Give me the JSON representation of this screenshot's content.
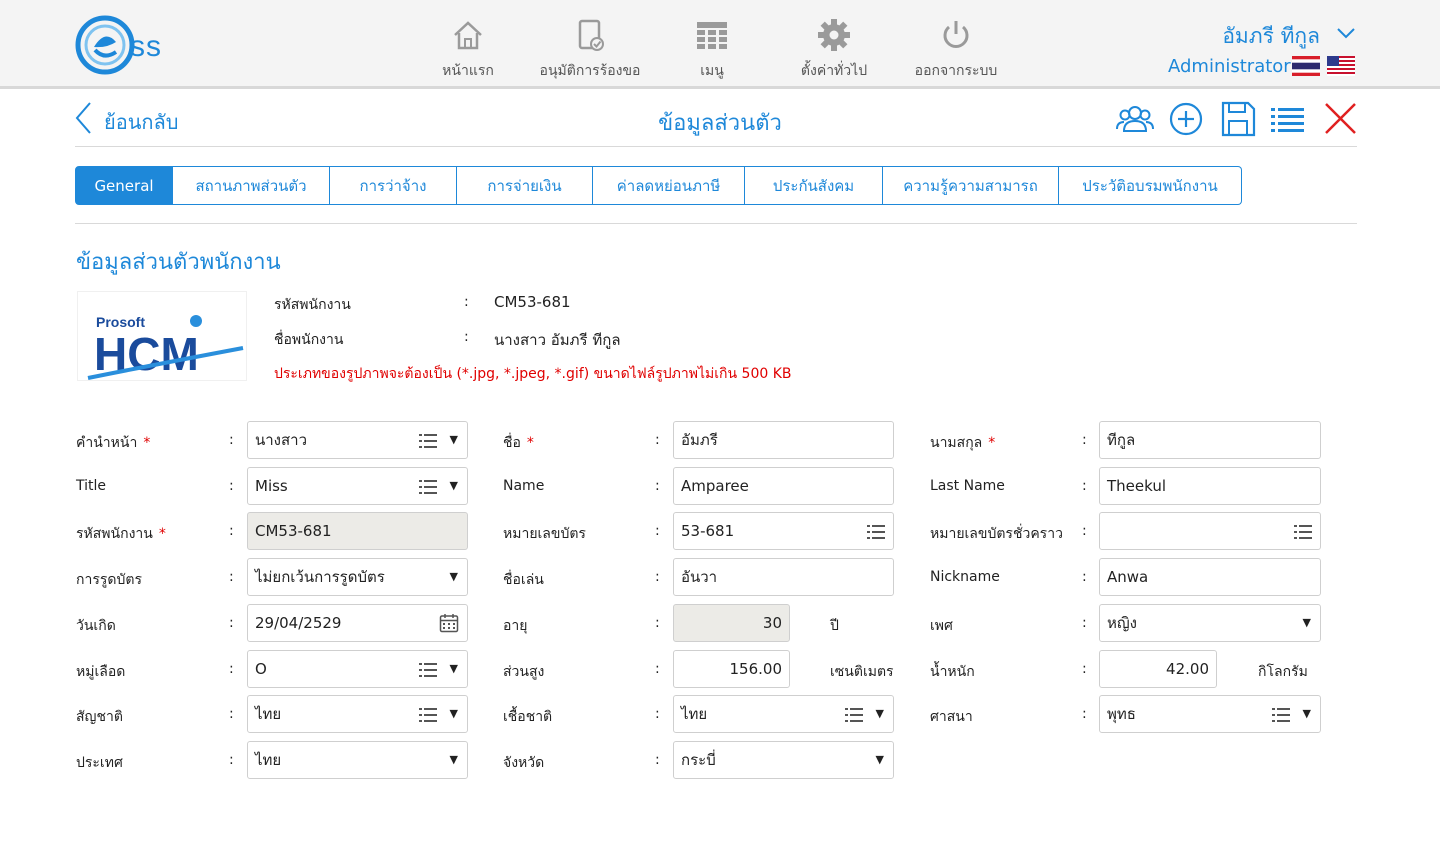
{
  "brand": {
    "logo_text": "ss"
  },
  "nav": [
    {
      "label": "หน้าแรก",
      "icon": "home-icon"
    },
    {
      "label": "อนุมัติการร้องขอ",
      "icon": "approve-document-icon"
    },
    {
      "label": "เมนู",
      "icon": "menu-grid-icon"
    },
    {
      "label": "ตั้งค่าทั่วไป",
      "icon": "gear-icon"
    },
    {
      "label": "ออกจากระบบ",
      "icon": "power-icon"
    }
  ],
  "user": {
    "name": "อัมภรี ทีกูล",
    "role": "Administrator"
  },
  "titlebar": {
    "back_label": "ย้อนกลับ",
    "title": "ข้อมูลส่วนตัว"
  },
  "toolbar": [
    "group-users-icon",
    "add-icon",
    "save-icon",
    "list-icon",
    "close-icon"
  ],
  "tabs": [
    {
      "label": "General",
      "active": true
    },
    {
      "label": "สถานภาพส่วนตัว",
      "active": false
    },
    {
      "label": "การว่าจ้าง",
      "active": false
    },
    {
      "label": "การจ่ายเงิน",
      "active": false
    },
    {
      "label": "ค่าลดหย่อนภาษี",
      "active": false
    },
    {
      "label": "ประกันสังคม",
      "active": false
    },
    {
      "label": "ความรู้ความสามารถ",
      "active": false
    },
    {
      "label": "ประวัติอบรมพนักงาน",
      "active": false
    }
  ],
  "section_title": "ข้อมูลส่วนตัวพนักงาน",
  "photo": {
    "line1": "Prosoft",
    "line2": "HCM"
  },
  "info": {
    "emp_code_label": "รหัสพนักงาน",
    "emp_code": "CM53-681",
    "emp_name_label": "ชื่อพนักงาน",
    "emp_name": "นางสาว อัมภรี ทีกูล",
    "colon": ":",
    "notice": "ประเภทของรูปภาพจะต้องเป็น (*.jpg, *.jpeg, *.gif) ขนาดไฟล์รูปภาพไม่เกิน 500 KB"
  },
  "form": {
    "colon": ":",
    "required_mark": "*",
    "prefix": {
      "label": "คำนำหน้า",
      "value": "นางสาว"
    },
    "first_name": {
      "label": "ชื่อ",
      "value": "อัมภรี"
    },
    "last_name": {
      "label": "นามสกุล",
      "value": "ทีกูล"
    },
    "title_en": {
      "label": "Title",
      "value": "Miss"
    },
    "name_en": {
      "label": "Name",
      "value": "Amparee"
    },
    "last_name_en": {
      "label": "Last Name",
      "value": "Theekul"
    },
    "emp_code": {
      "label": "รหัสพนักงาน",
      "value": "CM53-681"
    },
    "id_card": {
      "label": "หมายเลขบัตร",
      "value": "53-681"
    },
    "temp_card": {
      "label": "หมายเลขบัตรชั่วคราว",
      "value": ""
    },
    "card_swipe": {
      "label": "การรูดบัตร",
      "value": "ไม่ยกเว้นการรูดบัตร"
    },
    "nickname_th": {
      "label": "ชื่อเล่น",
      "value": "อันวา"
    },
    "nickname_en": {
      "label": "Nickname",
      "value": "Anwa"
    },
    "birth_date": {
      "label": "วันเกิด",
      "value": "29/04/2529"
    },
    "age": {
      "label": "อายุ",
      "value": "30",
      "unit": "ปี"
    },
    "gender": {
      "label": "เพศ",
      "value": "หญิง"
    },
    "blood_group": {
      "label": "หมู่เลือด",
      "value": "O"
    },
    "height": {
      "label": "ส่วนสูง",
      "value": "156.00",
      "unit": "เซนติเมตร"
    },
    "weight": {
      "label": "น้ำหนัก",
      "value": "42.00",
      "unit": "กิโลกรัม"
    },
    "nationality": {
      "label": "สัญชาติ",
      "value": "ไทย"
    },
    "race": {
      "label": "เชื้อชาติ",
      "value": "ไทย"
    },
    "religion": {
      "label": "ศาสนา",
      "value": "พุทธ"
    },
    "country": {
      "label": "ประเทศ",
      "value": "ไทย"
    },
    "province": {
      "label": "จังหวัด",
      "value": "กระบี่"
    }
  },
  "colors": {
    "accent": "#1e88d9",
    "required": "#e00000",
    "disabled_bg": "#ecebe7"
  }
}
